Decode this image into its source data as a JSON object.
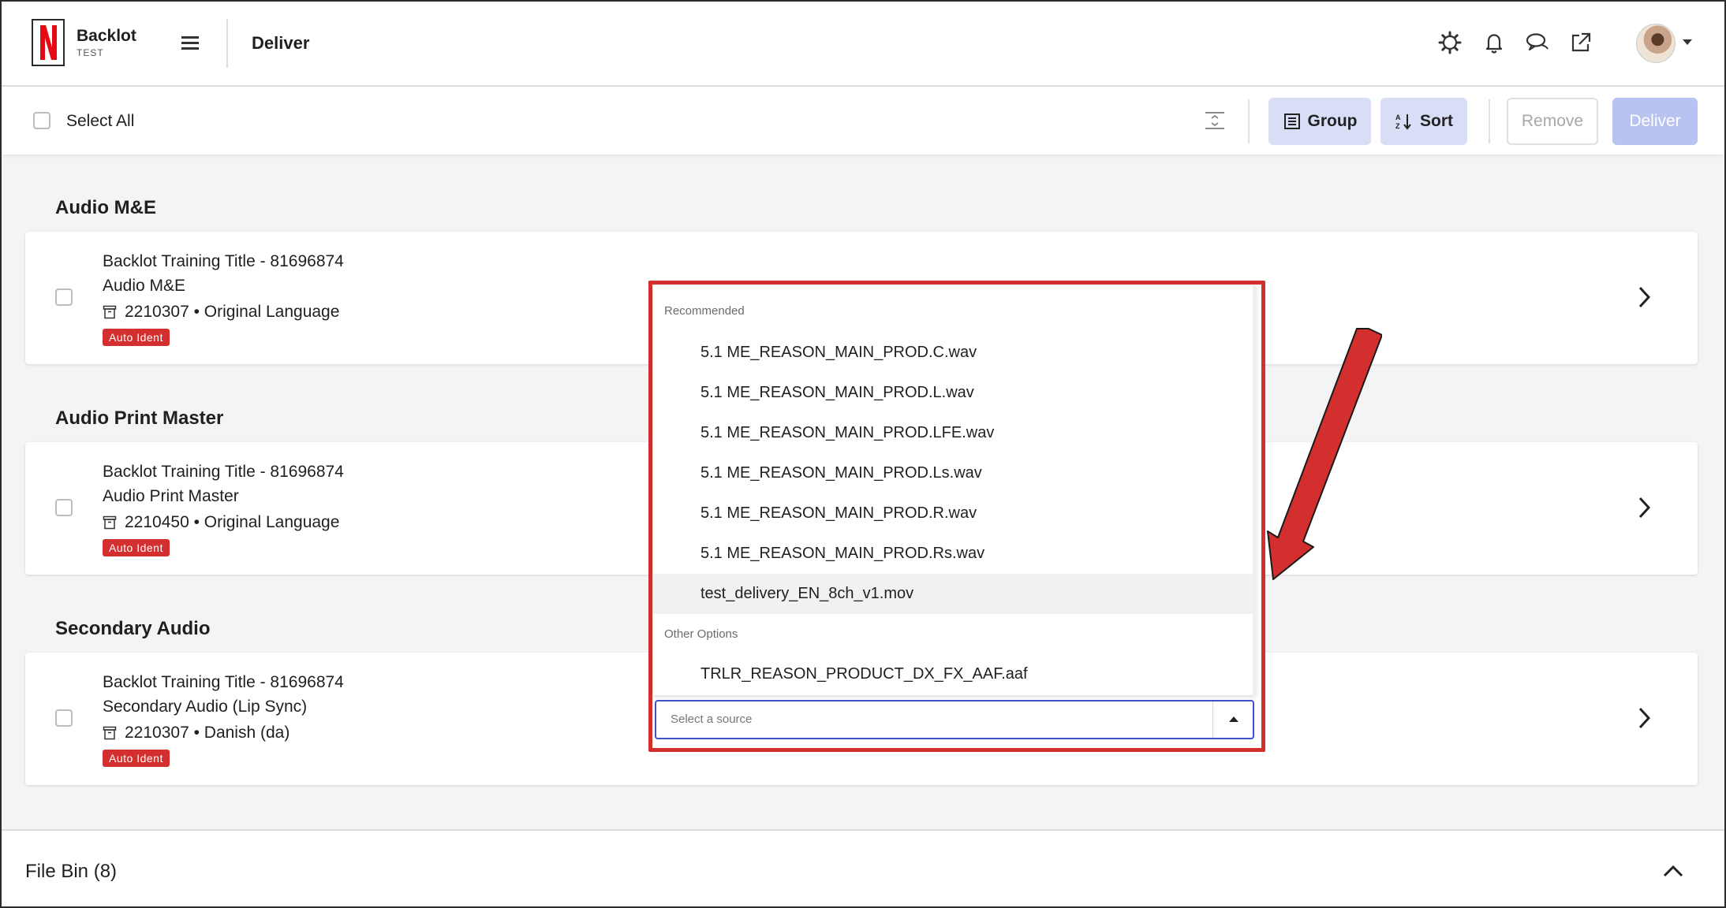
{
  "header": {
    "brand_title": "Backlot",
    "brand_sub": "TEST",
    "page_title": "Deliver",
    "logo_letter": "N",
    "icons": [
      "settings-icon",
      "bell-icon",
      "chat-icon",
      "external-link-icon"
    ]
  },
  "toolbar": {
    "select_all_label": "Select All",
    "group_label": "Group",
    "sort_label": "Sort",
    "remove_label": "Remove",
    "deliver_label": "Deliver"
  },
  "sections": [
    {
      "title": "Audio M&E",
      "card": {
        "title": "Backlot Training Title - 81696874",
        "subtitle": "Audio M&E",
        "meta": "2210307 • Original Language",
        "badge": "Auto Ident"
      }
    },
    {
      "title": "Audio Print Master",
      "card": {
        "title": "Backlot Training Title - 81696874",
        "subtitle": "Audio Print Master",
        "meta": "2210450 • Original Language",
        "badge": "Auto Ident"
      }
    },
    {
      "title": "Secondary Audio",
      "card": {
        "title": "Backlot Training Title - 81696874",
        "subtitle": "Secondary Audio (Lip Sync)",
        "meta": "2210307 • Danish (da)",
        "badge": "Auto Ident"
      }
    }
  ],
  "dropdown": {
    "recommended_label": "Recommended",
    "recommended": [
      "5.1 ME_REASON_MAIN_PROD.C.wav",
      "5.1 ME_REASON_MAIN_PROD.L.wav",
      "5.1 ME_REASON_MAIN_PROD.LFE.wav",
      "5.1 ME_REASON_MAIN_PROD.Ls.wav",
      "5.1 ME_REASON_MAIN_PROD.R.wav",
      "5.1 ME_REASON_MAIN_PROD.Rs.wav",
      "test_delivery_EN_8ch_v1.mov"
    ],
    "other_label": "Other Options",
    "other": [
      "TRLR_REASON_PRODUCT_DX_FX_AAF.aaf"
    ],
    "placeholder": "Select a source",
    "highlight_color": "#d32f2f"
  },
  "file_bin": {
    "title": "File Bin (8)"
  },
  "colors": {
    "accent": "#3f51c8",
    "button_bg": "#d9def7",
    "deliver_disabled": "#b8c3f2",
    "badge_red": "#d32f2f"
  }
}
